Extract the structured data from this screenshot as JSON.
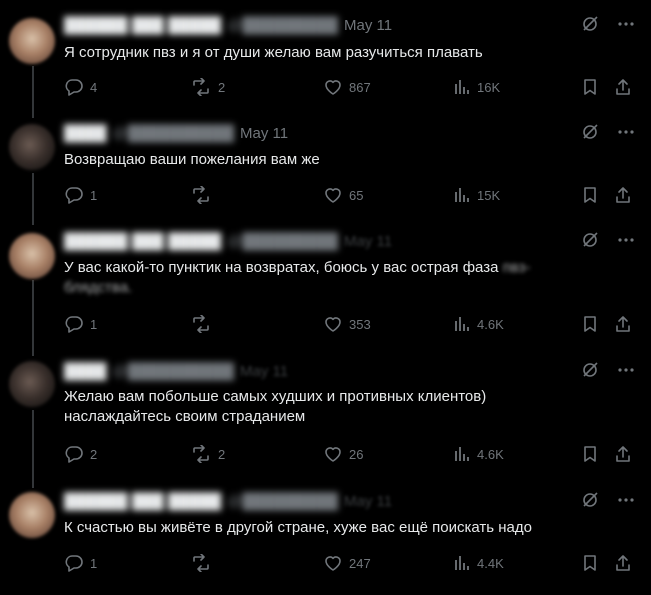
{
  "tweets": [
    {
      "date": "May 11",
      "text": "Я сотрудник пвз и я от души желаю вам разучиться плавать",
      "text_tail": "",
      "replies": "4",
      "reposts": "2",
      "likes": "867",
      "views": "16K",
      "date_faded": false
    },
    {
      "date": "May 11",
      "text": "Возвращаю ваши пожелания вам же",
      "text_tail": "",
      "replies": "1",
      "reposts": "",
      "likes": "65",
      "views": "15K",
      "date_faded": false
    },
    {
      "date": "May 11",
      "text": "У вас какой-то пунктик на возвратах, боюсь у вас острая фаза ",
      "text_tail": "пвз-блядства.",
      "replies": "1",
      "reposts": "",
      "likes": "353",
      "views": "4.6K",
      "date_faded": true
    },
    {
      "date": "May 11",
      "text": "Желаю вам побольше самых худших и противных клиентов) наслаждайтесь своим страданием",
      "text_tail": "",
      "replies": "2",
      "reposts": "2",
      "likes": "26",
      "views": "4.6K",
      "date_faded": true
    },
    {
      "date": "May 11",
      "text": "К счастью вы живёте в другой стране, хуже вас ещё поискать надо",
      "text_tail": "",
      "replies": "1",
      "reposts": "",
      "likes": "247",
      "views": "4.4K",
      "date_faded": true
    }
  ],
  "icons": {
    "grok": "grok-icon",
    "more": "more-icon",
    "reply": "reply-icon",
    "repost": "repost-icon",
    "like": "like-icon",
    "views": "views-icon",
    "bookmark": "bookmark-icon",
    "share": "share-icon"
  },
  "colors": {
    "background": "#000000",
    "text": "#e7e9ea",
    "secondary": "#71767b",
    "thread_line": "#333639"
  }
}
